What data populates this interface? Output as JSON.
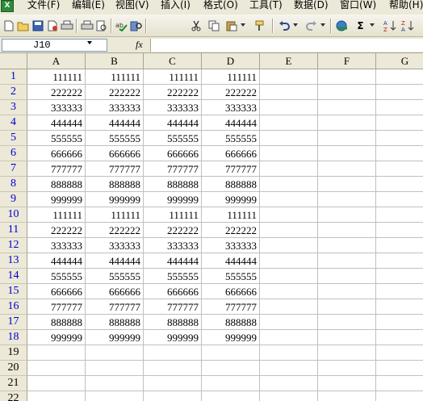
{
  "menubar": {
    "app_icon_text": "X",
    "items": [
      {
        "label": "文件(F)"
      },
      {
        "label": "编辑(E)"
      },
      {
        "label": "视图(V)"
      },
      {
        "label": "插入(I)"
      },
      {
        "label": "格式(O)"
      },
      {
        "label": "工具(T)"
      },
      {
        "label": "数据(D)"
      },
      {
        "label": "窗口(W)"
      },
      {
        "label": "帮助(H)"
      }
    ]
  },
  "toolbar": {
    "icons": [
      "new-document-icon",
      "open-folder-icon",
      "save-icon",
      "permission-icon",
      "print-icon",
      "print-preview-icon",
      "spelling-icon",
      "research-icon",
      "cut-icon",
      "copy-icon",
      "paste-icon",
      "format-painter-icon",
      "undo-icon",
      "redo-icon",
      "hyperlink-icon",
      "autosum-icon",
      "sort-ascending-icon",
      "sort-descending-icon"
    ],
    "autosum_glyph": "Σ"
  },
  "formula_bar": {
    "name_box_value": "J10",
    "fx_label": "fx",
    "formula_value": ""
  },
  "sheet": {
    "columns": [
      "A",
      "B",
      "C",
      "D",
      "E",
      "F",
      "G"
    ],
    "rows": [
      "1",
      "2",
      "3",
      "4",
      "5",
      "6",
      "7",
      "8",
      "9",
      "10",
      "11",
      "12",
      "13",
      "14",
      "15",
      "16",
      "17",
      "18",
      "19",
      "20",
      "21",
      "22"
    ],
    "cells": [
      [
        "111111",
        "111111",
        "111111",
        "111111"
      ],
      [
        "222222",
        "222222",
        "222222",
        "222222"
      ],
      [
        "333333",
        "333333",
        "333333",
        "333333"
      ],
      [
        "444444",
        "444444",
        "444444",
        "444444"
      ],
      [
        "555555",
        "555555",
        "555555",
        "555555"
      ],
      [
        "666666",
        "666666",
        "666666",
        "666666"
      ],
      [
        "777777",
        "777777",
        "777777",
        "777777"
      ],
      [
        "888888",
        "888888",
        "888888",
        "888888"
      ],
      [
        "999999",
        "999999",
        "999999",
        "999999"
      ],
      [
        "111111",
        "111111",
        "111111",
        "111111"
      ],
      [
        "222222",
        "222222",
        "222222",
        "222222"
      ],
      [
        "333333",
        "333333",
        "333333",
        "333333"
      ],
      [
        "444444",
        "444444",
        "444444",
        "444444"
      ],
      [
        "555555",
        "555555",
        "555555",
        "555555"
      ],
      [
        "666666",
        "666666",
        "666666",
        "666666"
      ],
      [
        "777777",
        "777777",
        "777777",
        "777777"
      ],
      [
        "888888",
        "888888",
        "888888",
        "888888"
      ],
      [
        "999999",
        "999999",
        "999999",
        "999999"
      ]
    ],
    "row_number_color": "#0000cc",
    "row_number_plain_color": "#000000"
  }
}
